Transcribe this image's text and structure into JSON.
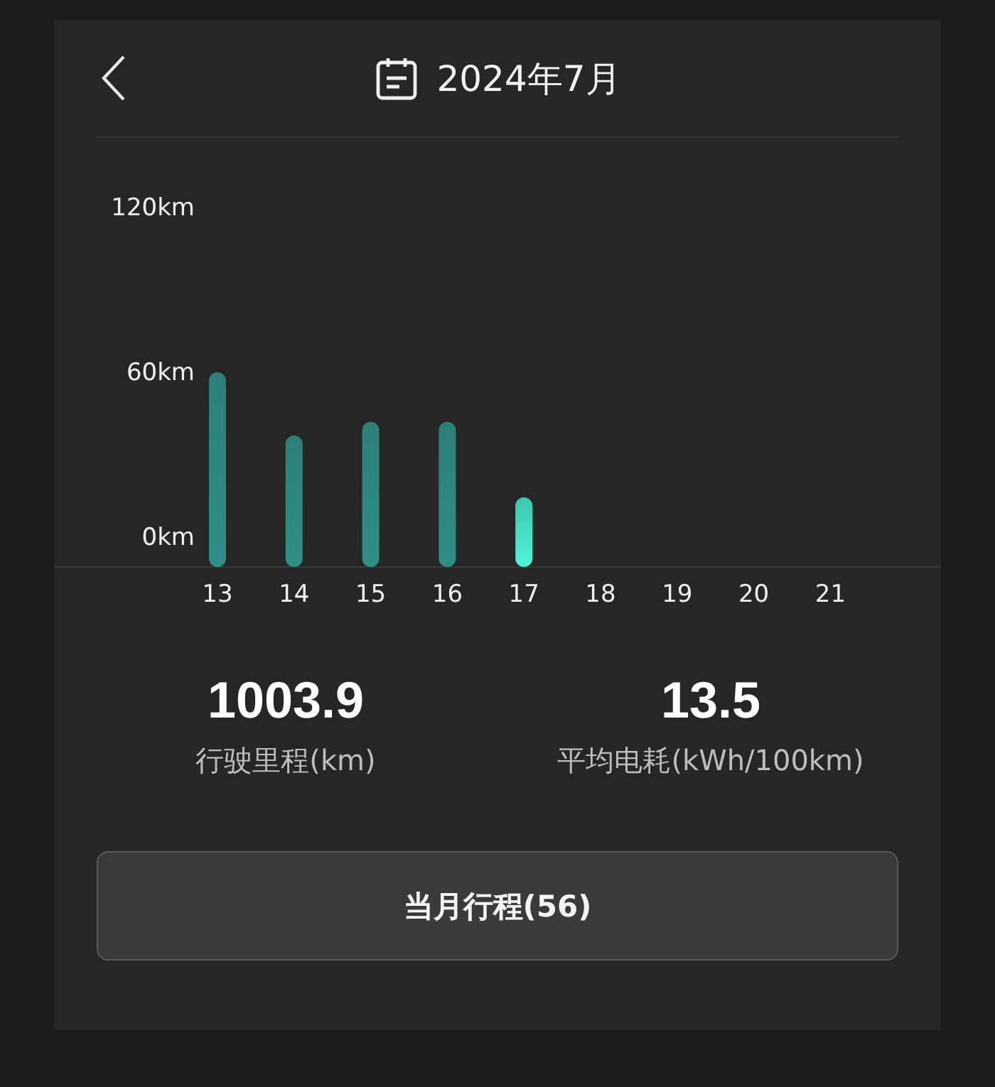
{
  "header": {
    "title": "2024年7月"
  },
  "chart": {
    "selected_day": "17",
    "chart_data": {
      "type": "bar",
      "categories": [
        "13",
        "14",
        "15",
        "16",
        "17",
        "18",
        "19",
        "20",
        "21"
      ],
      "series": [
        {
          "color": "#2f8f86",
          "values": [
            60.5,
            37.5,
            42.5,
            42.5,
            15,
            null,
            null,
            null,
            null
          ]
        }
      ],
      "ylim": [
        0,
        120
      ],
      "yticks": [
        {
          "value": 0,
          "label": "0km"
        },
        {
          "value": 60,
          "label": "60km"
        },
        {
          "value": 120,
          "label": "120km"
        }
      ]
    }
  },
  "stats": [
    {
      "value": "1003.9",
      "label": "行驶里程(km)"
    },
    {
      "value": "13.5",
      "label": "平均电耗(kWh/100km)"
    }
  ],
  "button": {
    "label": "当月行程(56)"
  }
}
